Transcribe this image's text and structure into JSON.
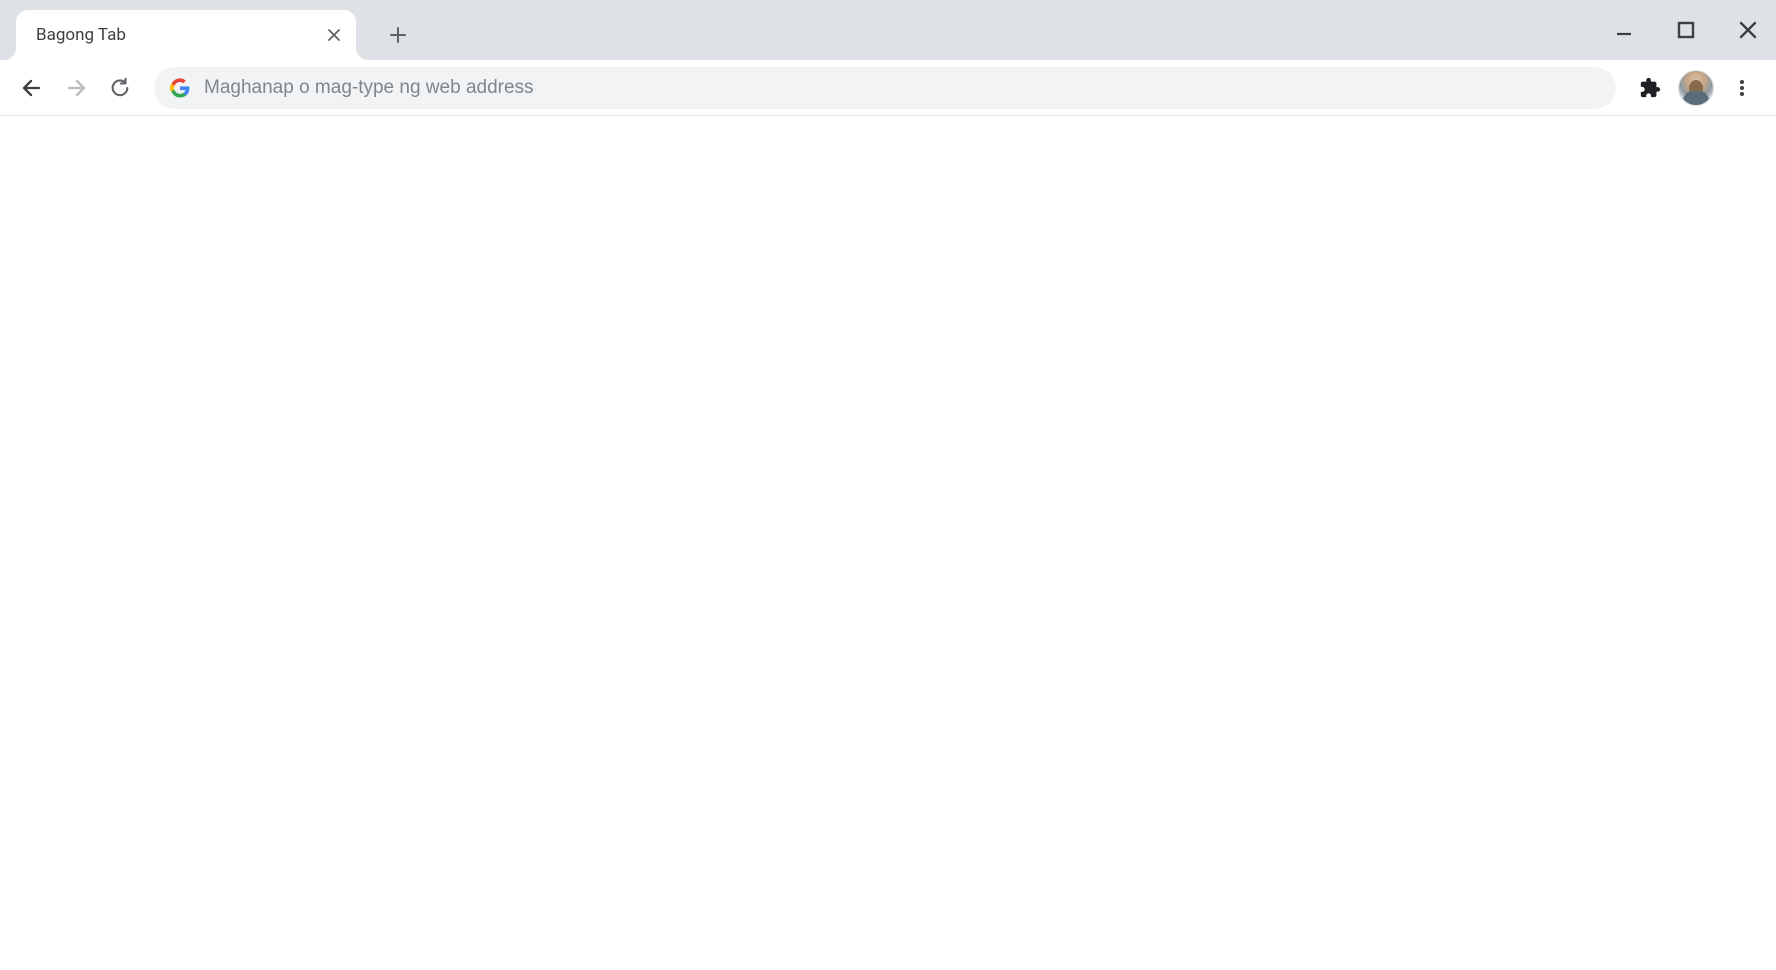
{
  "tabs": {
    "active": {
      "title": "Bagong Tab"
    }
  },
  "omnibox": {
    "placeholder": "Maghanap o mag-type ng web address",
    "value": ""
  }
}
